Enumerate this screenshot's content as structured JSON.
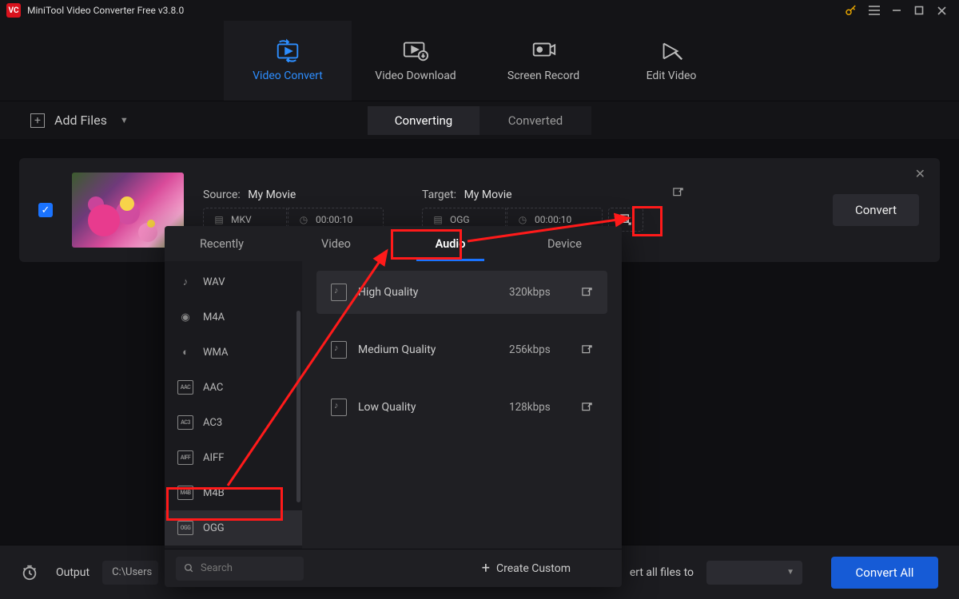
{
  "app": {
    "title": "MiniTool Video Converter Free v3.8.0"
  },
  "nav": {
    "items": [
      {
        "label": "Video Convert"
      },
      {
        "label": "Video Download"
      },
      {
        "label": "Screen Record"
      },
      {
        "label": "Edit Video"
      }
    ],
    "active": 0
  },
  "toolbar": {
    "add_files": "Add Files",
    "seg_converting": "Converting",
    "seg_converted": "Converted"
  },
  "file": {
    "source_label": "Source:",
    "source_name": "My Movie",
    "source_format": "MKV",
    "source_duration": "00:00:10",
    "target_label": "Target:",
    "target_name": "My Movie",
    "target_format": "OGG",
    "target_duration": "00:00:10",
    "convert_btn": "Convert"
  },
  "popup": {
    "tabs": [
      "Recently",
      "Video",
      "Audio",
      "Device"
    ],
    "active_tab": 2,
    "formats": [
      "WAV",
      "M4A",
      "WMA",
      "AAC",
      "AC3",
      "AIFF",
      "M4B",
      "OGG"
    ],
    "selected_format": "OGG",
    "qualities": [
      {
        "label": "High Quality",
        "rate": "320kbps"
      },
      {
        "label": "Medium Quality",
        "rate": "256kbps"
      },
      {
        "label": "Low Quality",
        "rate": "128kbps"
      }
    ],
    "selected_quality": 0,
    "search_placeholder": "Search",
    "create_custom": "Create Custom"
  },
  "footer": {
    "output_label": "Output",
    "output_path": "C:\\Users",
    "target_all_prefix": "ert all files to",
    "convert_all": "Convert All"
  },
  "colors": {
    "accent": "#2d8eff",
    "danger_red": "#ff1a1a",
    "primary_btn": "#165bd6"
  }
}
